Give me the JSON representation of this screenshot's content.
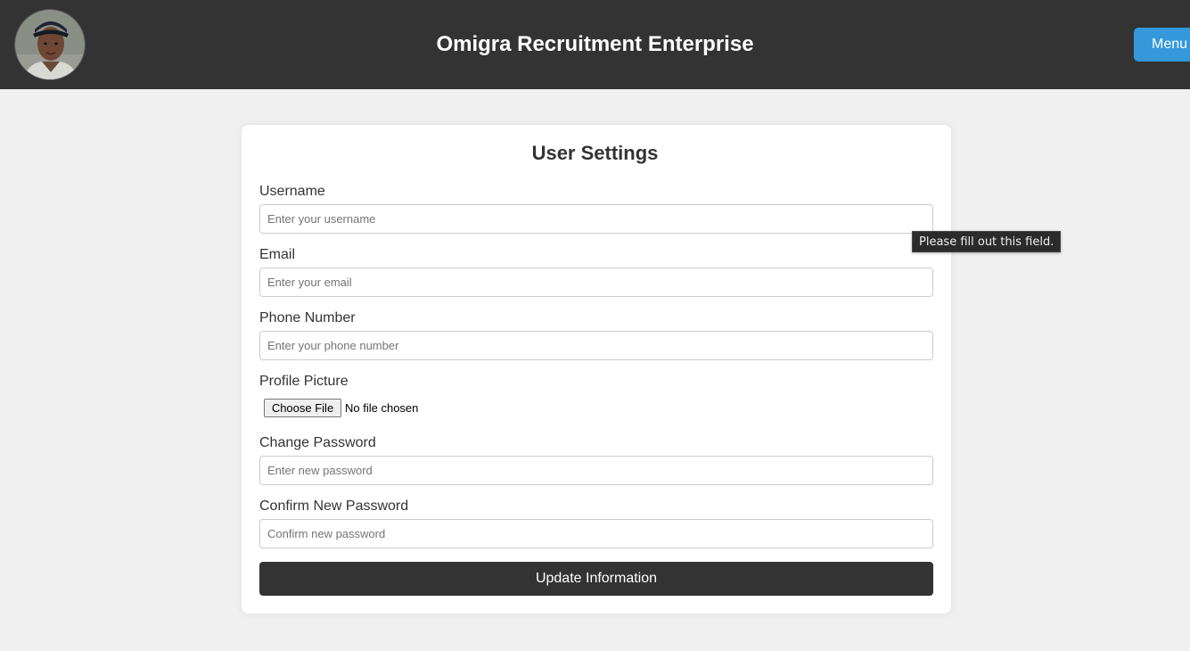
{
  "header": {
    "title": "Omigra Recruitment Enterprise",
    "menu_label": "Menu",
    "avatar_icon": "user-photo"
  },
  "settings": {
    "title": "User Settings",
    "username": {
      "label": "Username",
      "placeholder": "Enter your username",
      "value": ""
    },
    "email": {
      "label": "Email",
      "placeholder": "Enter your email",
      "value": ""
    },
    "phone": {
      "label": "Phone Number",
      "placeholder": "Enter your phone number",
      "value": ""
    },
    "profile_picture": {
      "label": "Profile Picture",
      "button_label": "Choose File",
      "status": "No file chosen"
    },
    "new_password": {
      "label": "Change Password",
      "placeholder": "Enter new password",
      "value": ""
    },
    "confirm_password": {
      "label": "Confirm New Password",
      "placeholder": "Confirm new password",
      "value": ""
    },
    "submit_label": "Update Information"
  },
  "tooltip": {
    "text": "Please fill out this field."
  },
  "colors": {
    "header_bg": "#333333",
    "page_bg": "#f0f0f0",
    "accent": "#3498db",
    "submit_bg": "#333333"
  }
}
